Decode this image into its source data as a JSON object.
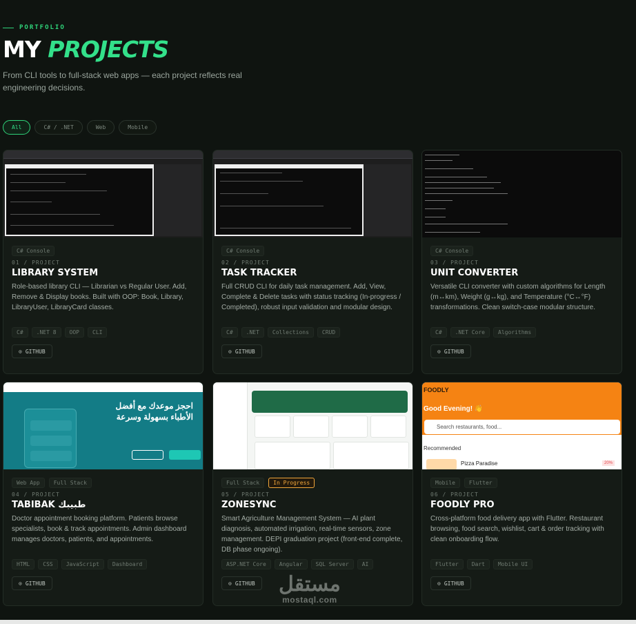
{
  "header": {
    "eyebrow": "PORTFOLIO",
    "title_white": "MY ",
    "title_accent": "PROJECTS",
    "subtitle": "From CLI tools to full-stack web apps — each project reflects real engineering decisions."
  },
  "filters": [
    {
      "label": "All",
      "active": true
    },
    {
      "label": "C# / .NET",
      "active": false
    },
    {
      "label": "Web",
      "active": false
    },
    {
      "label": "Mobile",
      "active": false
    }
  ],
  "projects": [
    {
      "category_tags": [
        "C# Console"
      ],
      "number": "01 / PROJECT",
      "name": "LIBRARY SYSTEM",
      "description": "Role-based library CLI — Librarian vs Regular User. Add, Remove & Display books. Built with OOP: Book, Library, LibraryUser, LibraryCard classes.",
      "tech": [
        "C#",
        ".NET 8",
        "OOP",
        "CLI"
      ],
      "github_label": "GITHUB"
    },
    {
      "category_tags": [
        "C# Console"
      ],
      "number": "02 / PROJECT",
      "name": "TASK TRACKER",
      "description": "Full CRUD CLI for daily task management. Add, View, Complete & Delete tasks with status tracking (In-progress / Completed), robust input validation and modular design.",
      "tech": [
        "C#",
        ".NET",
        "Collections",
        "CRUD"
      ],
      "github_label": "GITHUB"
    },
    {
      "category_tags": [
        "C# Console"
      ],
      "number": "03 / PROJECT",
      "name": "UNIT CONVERTER",
      "description": "Versatile CLI converter with custom algorithms for Length (m↔km), Weight (g↔kg), and Temperature (°C↔°F) transformations. Clean switch-case modular structure.",
      "tech": [
        "C#",
        ".NET Core",
        "Algorithms"
      ],
      "github_label": "GITHUB"
    },
    {
      "category_tags": [
        "Web App",
        "Full Stack"
      ],
      "number": "04 / PROJECT",
      "name": "TABIBAK طبيبك",
      "description": "Doctor appointment booking platform. Patients browse specialists, book & track appointments. Admin dashboard manages doctors, patients, and appointments.",
      "tech": [
        "HTML",
        "CSS",
        "JavaScript",
        "Dashboard"
      ],
      "github_label": "GITHUB"
    },
    {
      "category_tags": [
        "Full Stack"
      ],
      "status_tag": "In Progress",
      "number": "05 / PROJECT",
      "name": "ZONESYNC",
      "description": "Smart Agriculture Management System — AI plant diagnosis, automated irrigation, real-time sensors, zone management. DEPI graduation project (front-end complete, DB phase ongoing).",
      "tech": [
        "ASP.NET Core",
        "Angular",
        "SQL Server",
        "AI"
      ],
      "github_label": "GITHUB"
    },
    {
      "category_tags": [
        "Mobile",
        "Flutter"
      ],
      "number": "06 / PROJECT",
      "name": "FOODLY PRO",
      "description": "Cross-platform food delivery app with Flutter. Restaurant browsing, food search, wishlist, cart & order tracking with clean onboarding flow.",
      "tech": [
        "Flutter",
        "Dart",
        "Mobile UI"
      ],
      "github_label": "GITHUB"
    }
  ],
  "screens": {
    "tabibak_heading": "احجز موعدك مع أفضل الأطباء بسهولة وسرعة",
    "foodly_brand": "FOODLY",
    "foodly_greeting": "Good Evening! 👋",
    "foodly_search": "Search restaurants, food...",
    "foodly_recommended": "Recommended",
    "foodly_place": "Pizza Paradise",
    "foodly_discount": "20%"
  },
  "watermark": {
    "arabic": "مستقل",
    "latin": "mostaql.com"
  },
  "colors": {
    "background": "#0f1410",
    "accent": "#33e08a",
    "card": "#151b16",
    "in_progress": "#f2a73a"
  }
}
